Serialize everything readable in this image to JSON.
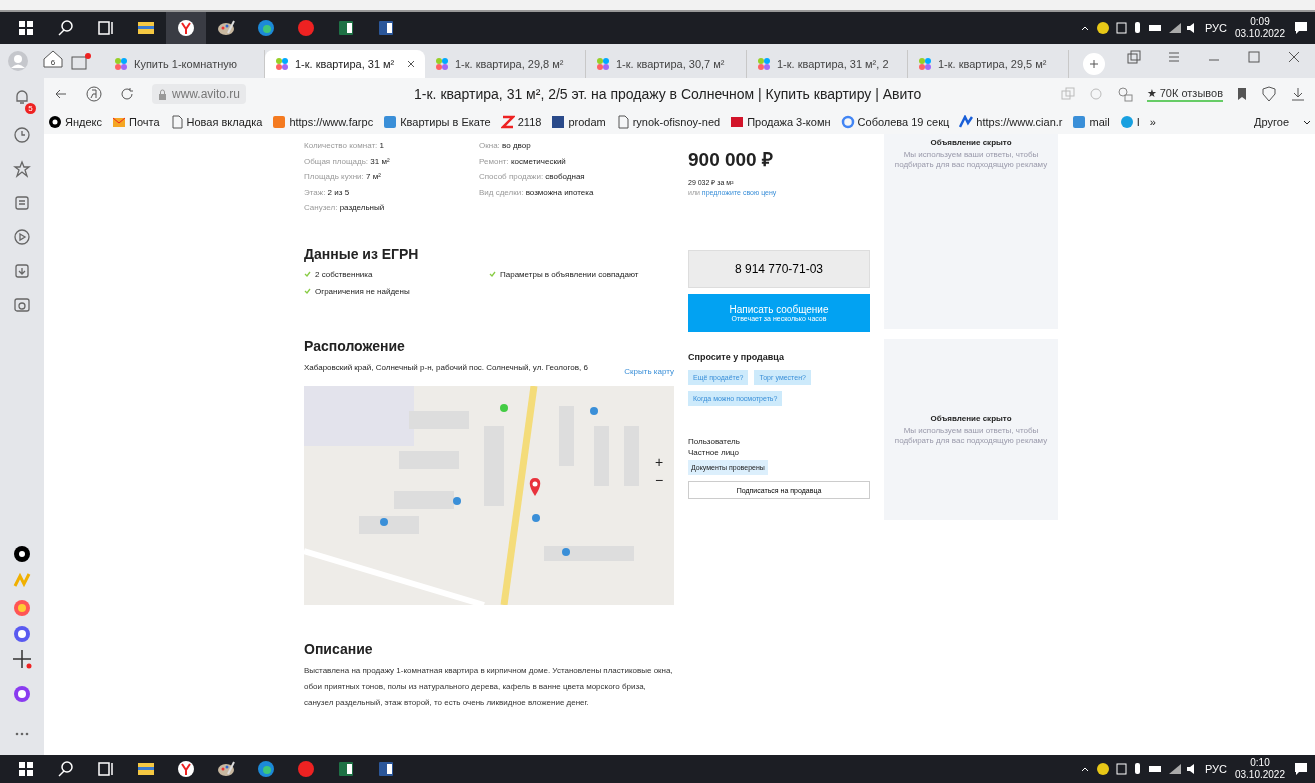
{
  "taskbar_top": {
    "apps": [
      {
        "kind": "windows",
        "selected": false
      },
      {
        "kind": "search",
        "selected": false
      },
      {
        "kind": "taskview",
        "selected": false
      },
      {
        "kind": "folder",
        "selected": false
      },
      {
        "kind": "ybrowser",
        "selected": true
      },
      {
        "kind": "paint",
        "selected": false
      },
      {
        "kind": "edge",
        "selected": false
      },
      {
        "kind": "yandex",
        "selected": false
      },
      {
        "kind": "excel",
        "selected": false
      },
      {
        "kind": "word",
        "selected": false
      }
    ],
    "lang": "РУС",
    "time": "0:09",
    "date": "03.10.2022"
  },
  "tabs": [
    {
      "title": "Купить 1-комнатную",
      "selected": false,
      "closable": false
    },
    {
      "title": "1-к. квартира, 31 м²",
      "selected": true,
      "closable": true
    },
    {
      "title": "1-к. квартира, 29,8 м²",
      "selected": false,
      "closable": false
    },
    {
      "title": "1-к. квартира, 30,7 м²",
      "selected": false,
      "closable": false
    },
    {
      "title": "1-к. квартира, 31 м², 2",
      "selected": false,
      "closable": false
    },
    {
      "title": "1-к. квартира, 29,5 м²",
      "selected": false,
      "closable": false
    }
  ],
  "home_count": "6",
  "notif_count": "5",
  "address": {
    "url": "www.avito.ru",
    "page_title": "1-к. квартира, 31 м², 2/5 эт. на продажу в Солнечном | Купить квартиру | Авито",
    "reviews": "★ 70К отзывов"
  },
  "bookmarks": [
    {
      "kind": "yandex",
      "label": "Яндекс"
    },
    {
      "kind": "mail",
      "label": "Почта"
    },
    {
      "kind": "page",
      "label": "Новая вкладка"
    },
    {
      "kind": "orange",
      "label": "https://www.farpc"
    },
    {
      "kind": "blue",
      "label": "Квартиры в Екате"
    },
    {
      "kind": "z",
      "label": "2118"
    },
    {
      "kind": "navy",
      "label": "prodam"
    },
    {
      "kind": "page",
      "label": "rynok-ofisnoy-ned"
    },
    {
      "kind": "red",
      "label": "Продажа 3-комн"
    },
    {
      "kind": "g",
      "label": "Соболева 19 секц"
    },
    {
      "kind": "cian",
      "label": "https://www.cian.r"
    },
    {
      "kind": "blue",
      "label": "mail"
    },
    {
      "kind": "cyan",
      "label": "I"
    }
  ],
  "bookmarks_more": "»",
  "bookmarks_other": "Другое",
  "params_left": [
    {
      "label": "Количество комнат:",
      "value": "1"
    },
    {
      "label": "Общая площадь:",
      "value": "31 м²"
    },
    {
      "label": "Площадь кухни:",
      "value": "7 м²"
    },
    {
      "label": "Этаж:",
      "value": "2 из 5"
    },
    {
      "label": "Санузел:",
      "value": "раздельный"
    }
  ],
  "params_right": [
    {
      "label": "Окна:",
      "value": "во двор"
    },
    {
      "label": "Ремонт:",
      "value": "косметический"
    },
    {
      "label": "Способ продажи:",
      "value": "свободная"
    },
    {
      "label": "Вид сделки:",
      "value": "возможна ипотека"
    }
  ],
  "egrn": {
    "title": "Данные из ЕГРН",
    "items": [
      "2 собственника",
      "Параметры в объявлении совпадают",
      "Ограничения не найдены"
    ]
  },
  "location": {
    "title": "Расположение",
    "address": "Хабаровский край, Солнечный р-н, рабочий пос. Солнечный, ул. Геологов, 6",
    "toggle": "Скрыть карту",
    "zoom_in": "+",
    "zoom_out": "−"
  },
  "description": {
    "title": "Описание",
    "text": "Выставлена на продажу 1-комнатная квартира в кирпичном доме. Установлены пластиковые окна, обои приятных тонов, полы из натурального дерева, кафель в ванне цвета морского бриза, санузел раздельный, этаж второй, то есть очень ликвидное вложение денег."
  },
  "price": {
    "amount": "900 000 ₽",
    "per_m2": "29 032 ₽ за м²",
    "offer_prefix": "или",
    "offer_link": "предложите свою цену"
  },
  "phone": "8 914 770-71-03",
  "message": {
    "label": "Написать сообщение",
    "sub": "Отвечает за несколько часов"
  },
  "ask": {
    "title": "Спросите у продавца",
    "chips": [
      "Ещё продаёте?",
      "Торг уместен?",
      "Когда можно посмотреть?"
    ]
  },
  "seller": {
    "name": "Пользователь",
    "type": "Частное лицо",
    "badge": "Документы проверены",
    "subscribe": "Подписаться на продавца"
  },
  "ads": [
    {
      "title": "Объявление скрыто",
      "text": "Мы используем ваши ответы, чтобы подбирать для вас подходящую рекламу"
    },
    {
      "title": "Объявление скрыто",
      "text": "Мы используем ваши ответы, чтобы подбирать для вас подходящую рекламу"
    }
  ],
  "taskbar_bottom": {
    "lang": "РУС",
    "time": "0:10",
    "date": "03.10.2022"
  }
}
